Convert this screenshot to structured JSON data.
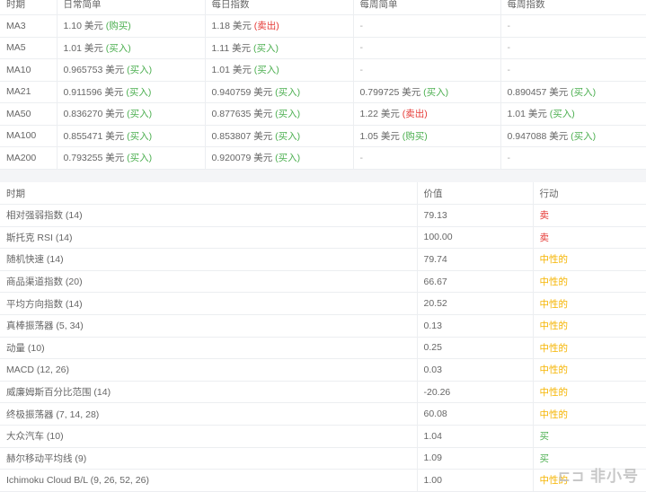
{
  "ma_table": {
    "headers": [
      "时期",
      "日常简单",
      "每日指数",
      "每周简单",
      "每周指数"
    ],
    "rows": [
      {
        "period": "MA3",
        "cells": [
          {
            "value": "1.10 美元",
            "action": "(购买)",
            "signal": "buy"
          },
          {
            "value": "1.18 美元",
            "action": "(卖出)",
            "signal": "sell"
          },
          {
            "value": "-"
          },
          {
            "value": "-"
          }
        ]
      },
      {
        "period": "MA5",
        "cells": [
          {
            "value": "1.01 美元",
            "action": "(买入)",
            "signal": "buy"
          },
          {
            "value": "1.11 美元",
            "action": "(买入)",
            "signal": "buy"
          },
          {
            "value": "-"
          },
          {
            "value": "-"
          }
        ]
      },
      {
        "period": "MA10",
        "cells": [
          {
            "value": "0.965753 美元",
            "action": "(买入)",
            "signal": "buy"
          },
          {
            "value": "1.01 美元",
            "action": "(买入)",
            "signal": "buy"
          },
          {
            "value": "-"
          },
          {
            "value": "-"
          }
        ]
      },
      {
        "period": "MA21",
        "cells": [
          {
            "value": "0.911596 美元",
            "action": "(买入)",
            "signal": "buy"
          },
          {
            "value": "0.940759 美元",
            "action": "(买入)",
            "signal": "buy"
          },
          {
            "value": "0.799725 美元",
            "action": "(买入)",
            "signal": "buy"
          },
          {
            "value": "0.890457 美元",
            "action": "(买入)",
            "signal": "buy"
          }
        ]
      },
      {
        "period": "MA50",
        "cells": [
          {
            "value": "0.836270 美元",
            "action": "(买入)",
            "signal": "buy"
          },
          {
            "value": "0.877635 美元",
            "action": "(买入)",
            "signal": "buy"
          },
          {
            "value": "1.22 美元",
            "action": "(卖出)",
            "signal": "sell"
          },
          {
            "value": "1.01 美元",
            "action": "(买入)",
            "signal": "buy"
          }
        ]
      },
      {
        "period": "MA100",
        "cells": [
          {
            "value": "0.855471 美元",
            "action": "(买入)",
            "signal": "buy"
          },
          {
            "value": "0.853807 美元",
            "action": "(买入)",
            "signal": "buy"
          },
          {
            "value": "1.05 美元",
            "action": "(购买)",
            "signal": "buy"
          },
          {
            "value": "0.947088 美元",
            "action": "(买入)",
            "signal": "buy"
          }
        ]
      },
      {
        "period": "MA200",
        "cells": [
          {
            "value": "0.793255 美元",
            "action": "(买入)",
            "signal": "buy"
          },
          {
            "value": "0.920079 美元",
            "action": "(买入)",
            "signal": "buy"
          },
          {
            "value": "-"
          },
          {
            "value": "-"
          }
        ]
      }
    ]
  },
  "oscillator_table": {
    "headers": [
      "时期",
      "价值",
      "行动"
    ],
    "rows": [
      {
        "name": "相对强弱指数 (14)",
        "value": "79.13",
        "action": "卖",
        "signal": "sell"
      },
      {
        "name": "斯托克 RSI (14)",
        "value": "100.00",
        "action": "卖",
        "signal": "sell"
      },
      {
        "name": "随机快速 (14)",
        "value": "79.74",
        "action": "中性的",
        "signal": "neutral"
      },
      {
        "name": "商品渠道指数 (20)",
        "value": "66.67",
        "action": "中性的",
        "signal": "neutral"
      },
      {
        "name": "平均方向指数 (14)",
        "value": "20.52",
        "action": "中性的",
        "signal": "neutral"
      },
      {
        "name": "真棒振荡器 (5, 34)",
        "value": "0.13",
        "action": "中性的",
        "signal": "neutral"
      },
      {
        "name": "动量 (10)",
        "value": "0.25",
        "action": "中性的",
        "signal": "neutral"
      },
      {
        "name": "MACD (12, 26)",
        "value": "0.03",
        "action": "中性的",
        "signal": "neutral"
      },
      {
        "name": "威廉姆斯百分比范围 (14)",
        "value": "-20.26",
        "action": "中性的",
        "signal": "neutral"
      },
      {
        "name": "终极振荡器 (7, 14, 28)",
        "value": "60.08",
        "action": "中性的",
        "signal": "neutral"
      },
      {
        "name": "大众汽车 (10)",
        "value": "1.04",
        "action": "买",
        "signal": "buy"
      },
      {
        "name": "赫尔移动平均线 (9)",
        "value": "1.09",
        "action": "买",
        "signal": "buy"
      },
      {
        "name": "Ichimoku Cloud B/L (9, 26, 52, 26)",
        "value": "1.00",
        "action": "中性的",
        "signal": "neutral"
      }
    ]
  },
  "colors": {
    "buy": "#4caf50",
    "sell": "#e53935",
    "neutral": "#f5b400"
  },
  "watermark": "非小号"
}
